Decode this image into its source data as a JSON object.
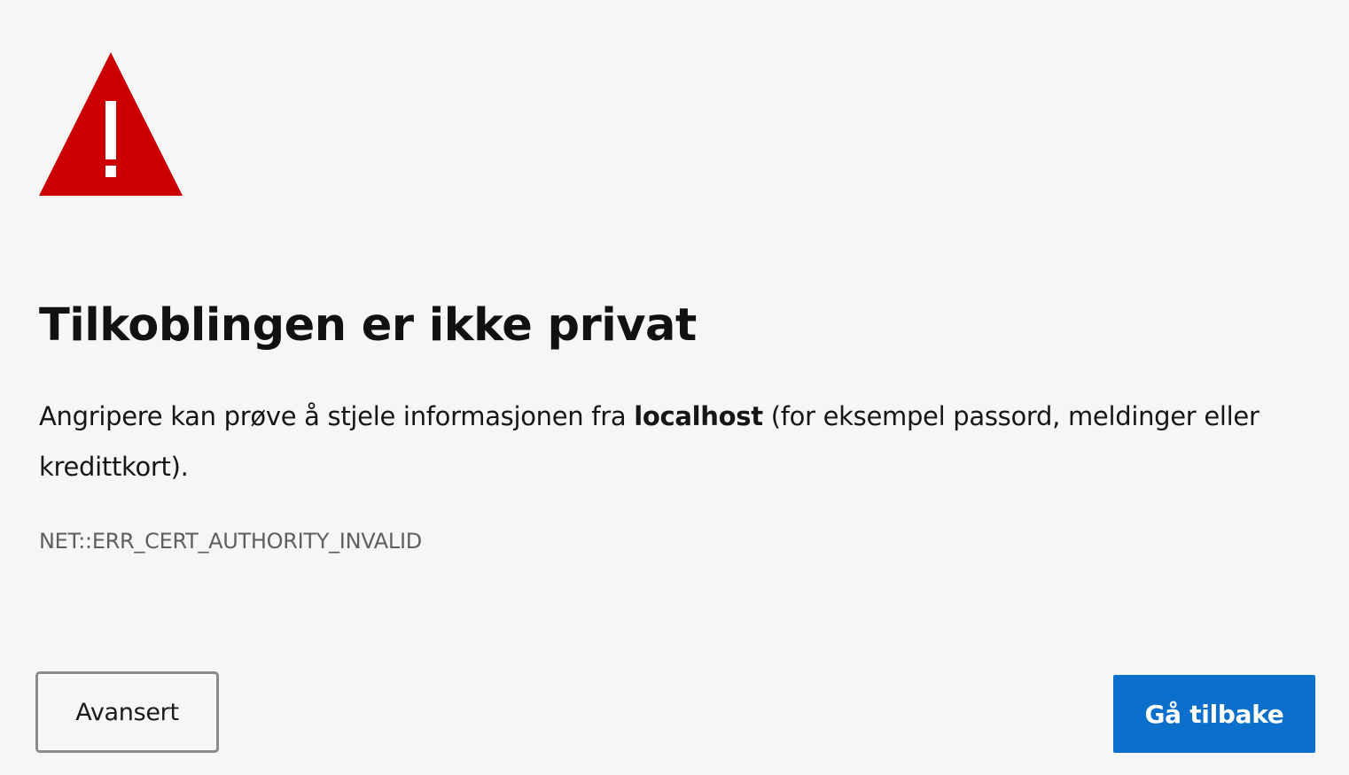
{
  "icon": {
    "name": "warning-triangle-icon",
    "color": "#cc0000",
    "mark_color": "#ffffff"
  },
  "page": {
    "title": "Tilkoblingen er ikke privat",
    "message": {
      "before": "Angripere kan prøve å stjele informasjonen fra ",
      "host": "localhost",
      "after": " (for eksempel passord, meldinger eller kredittkort)."
    },
    "error_code": "NET::ERR_CERT_AUTHORITY_INVALID"
  },
  "buttons": {
    "advanced_label": "Avansert",
    "back_label": "Gå tilbake",
    "back_color": "#0c6fcb"
  }
}
